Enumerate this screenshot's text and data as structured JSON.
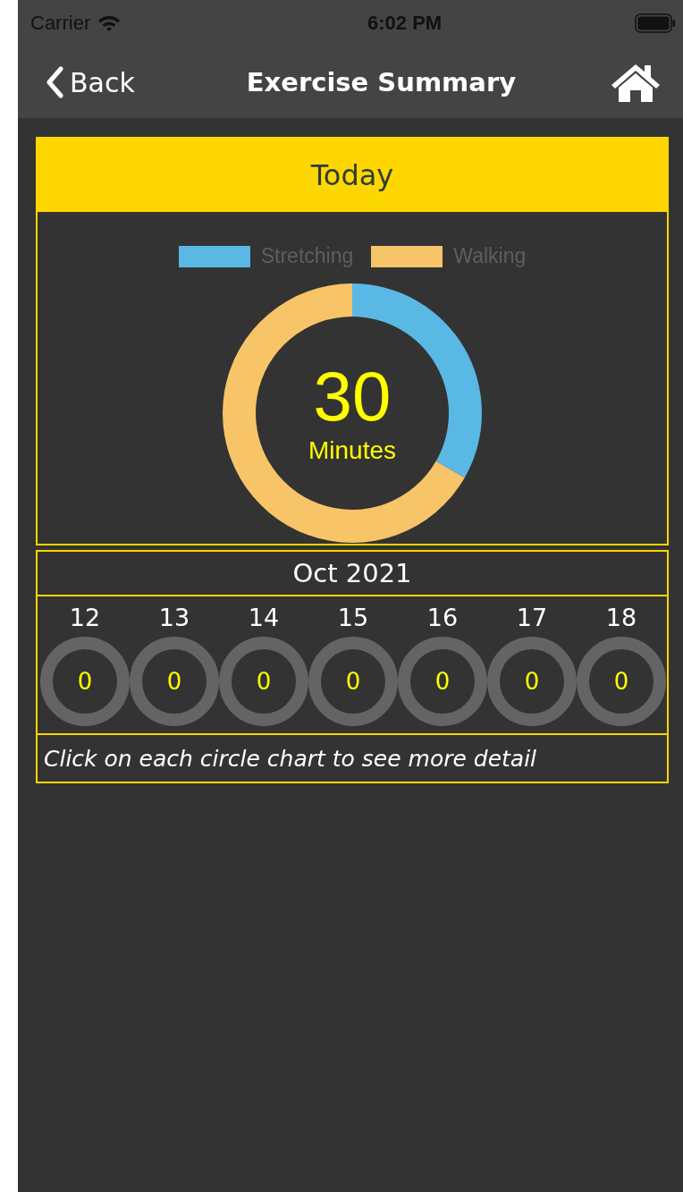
{
  "status_bar": {
    "carrier": "Carrier",
    "time": "6:02 PM"
  },
  "nav_bar": {
    "back": "Back",
    "title": "Exercise Summary"
  },
  "today_card": {
    "title": "Today",
    "total": "30",
    "unit": "Minutes",
    "chart_data": {
      "type": "donut",
      "categories": [
        "Stretching",
        "Walking"
      ],
      "series": [
        {
          "values": [
            33.3,
            66.7
          ]
        }
      ],
      "legend": true,
      "colors": [
        "#5ab8e4",
        "#f8c468"
      ]
    }
  },
  "week": {
    "month": "Oct 2021",
    "days": [
      {
        "day": "12",
        "value": "0"
      },
      {
        "day": "13",
        "value": "0"
      },
      {
        "day": "14",
        "value": "0"
      },
      {
        "day": "15",
        "value": "0"
      },
      {
        "day": "16",
        "value": "0"
      },
      {
        "day": "17",
        "value": "0"
      },
      {
        "day": "18",
        "value": "0"
      }
    ],
    "hint": "Click on each circle chart to see more detail"
  }
}
